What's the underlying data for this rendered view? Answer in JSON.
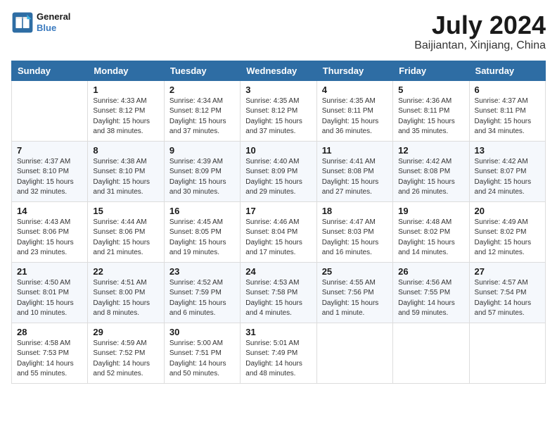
{
  "header": {
    "logo_line1": "General",
    "logo_line2": "Blue",
    "month_title": "July 2024",
    "location": "Baijiantan, Xinjiang, China"
  },
  "weekdays": [
    "Sunday",
    "Monday",
    "Tuesday",
    "Wednesday",
    "Thursday",
    "Friday",
    "Saturday"
  ],
  "weeks": [
    [
      {
        "day": "",
        "detail": ""
      },
      {
        "day": "1",
        "detail": "Sunrise: 4:33 AM\nSunset: 8:12 PM\nDaylight: 15 hours\nand 38 minutes."
      },
      {
        "day": "2",
        "detail": "Sunrise: 4:34 AM\nSunset: 8:12 PM\nDaylight: 15 hours\nand 37 minutes."
      },
      {
        "day": "3",
        "detail": "Sunrise: 4:35 AM\nSunset: 8:12 PM\nDaylight: 15 hours\nand 37 minutes."
      },
      {
        "day": "4",
        "detail": "Sunrise: 4:35 AM\nSunset: 8:11 PM\nDaylight: 15 hours\nand 36 minutes."
      },
      {
        "day": "5",
        "detail": "Sunrise: 4:36 AM\nSunset: 8:11 PM\nDaylight: 15 hours\nand 35 minutes."
      },
      {
        "day": "6",
        "detail": "Sunrise: 4:37 AM\nSunset: 8:11 PM\nDaylight: 15 hours\nand 34 minutes."
      }
    ],
    [
      {
        "day": "7",
        "detail": "Sunrise: 4:37 AM\nSunset: 8:10 PM\nDaylight: 15 hours\nand 32 minutes."
      },
      {
        "day": "8",
        "detail": "Sunrise: 4:38 AM\nSunset: 8:10 PM\nDaylight: 15 hours\nand 31 minutes."
      },
      {
        "day": "9",
        "detail": "Sunrise: 4:39 AM\nSunset: 8:09 PM\nDaylight: 15 hours\nand 30 minutes."
      },
      {
        "day": "10",
        "detail": "Sunrise: 4:40 AM\nSunset: 8:09 PM\nDaylight: 15 hours\nand 29 minutes."
      },
      {
        "day": "11",
        "detail": "Sunrise: 4:41 AM\nSunset: 8:08 PM\nDaylight: 15 hours\nand 27 minutes."
      },
      {
        "day": "12",
        "detail": "Sunrise: 4:42 AM\nSunset: 8:08 PM\nDaylight: 15 hours\nand 26 minutes."
      },
      {
        "day": "13",
        "detail": "Sunrise: 4:42 AM\nSunset: 8:07 PM\nDaylight: 15 hours\nand 24 minutes."
      }
    ],
    [
      {
        "day": "14",
        "detail": "Sunrise: 4:43 AM\nSunset: 8:06 PM\nDaylight: 15 hours\nand 23 minutes."
      },
      {
        "day": "15",
        "detail": "Sunrise: 4:44 AM\nSunset: 8:06 PM\nDaylight: 15 hours\nand 21 minutes."
      },
      {
        "day": "16",
        "detail": "Sunrise: 4:45 AM\nSunset: 8:05 PM\nDaylight: 15 hours\nand 19 minutes."
      },
      {
        "day": "17",
        "detail": "Sunrise: 4:46 AM\nSunset: 8:04 PM\nDaylight: 15 hours\nand 17 minutes."
      },
      {
        "day": "18",
        "detail": "Sunrise: 4:47 AM\nSunset: 8:03 PM\nDaylight: 15 hours\nand 16 minutes."
      },
      {
        "day": "19",
        "detail": "Sunrise: 4:48 AM\nSunset: 8:02 PM\nDaylight: 15 hours\nand 14 minutes."
      },
      {
        "day": "20",
        "detail": "Sunrise: 4:49 AM\nSunset: 8:02 PM\nDaylight: 15 hours\nand 12 minutes."
      }
    ],
    [
      {
        "day": "21",
        "detail": "Sunrise: 4:50 AM\nSunset: 8:01 PM\nDaylight: 15 hours\nand 10 minutes."
      },
      {
        "day": "22",
        "detail": "Sunrise: 4:51 AM\nSunset: 8:00 PM\nDaylight: 15 hours\nand 8 minutes."
      },
      {
        "day": "23",
        "detail": "Sunrise: 4:52 AM\nSunset: 7:59 PM\nDaylight: 15 hours\nand 6 minutes."
      },
      {
        "day": "24",
        "detail": "Sunrise: 4:53 AM\nSunset: 7:58 PM\nDaylight: 15 hours\nand 4 minutes."
      },
      {
        "day": "25",
        "detail": "Sunrise: 4:55 AM\nSunset: 7:56 PM\nDaylight: 15 hours\nand 1 minute."
      },
      {
        "day": "26",
        "detail": "Sunrise: 4:56 AM\nSunset: 7:55 PM\nDaylight: 14 hours\nand 59 minutes."
      },
      {
        "day": "27",
        "detail": "Sunrise: 4:57 AM\nSunset: 7:54 PM\nDaylight: 14 hours\nand 57 minutes."
      }
    ],
    [
      {
        "day": "28",
        "detail": "Sunrise: 4:58 AM\nSunset: 7:53 PM\nDaylight: 14 hours\nand 55 minutes."
      },
      {
        "day": "29",
        "detail": "Sunrise: 4:59 AM\nSunset: 7:52 PM\nDaylight: 14 hours\nand 52 minutes."
      },
      {
        "day": "30",
        "detail": "Sunrise: 5:00 AM\nSunset: 7:51 PM\nDaylight: 14 hours\nand 50 minutes."
      },
      {
        "day": "31",
        "detail": "Sunrise: 5:01 AM\nSunset: 7:49 PM\nDaylight: 14 hours\nand 48 minutes."
      },
      {
        "day": "",
        "detail": ""
      },
      {
        "day": "",
        "detail": ""
      },
      {
        "day": "",
        "detail": ""
      }
    ]
  ]
}
